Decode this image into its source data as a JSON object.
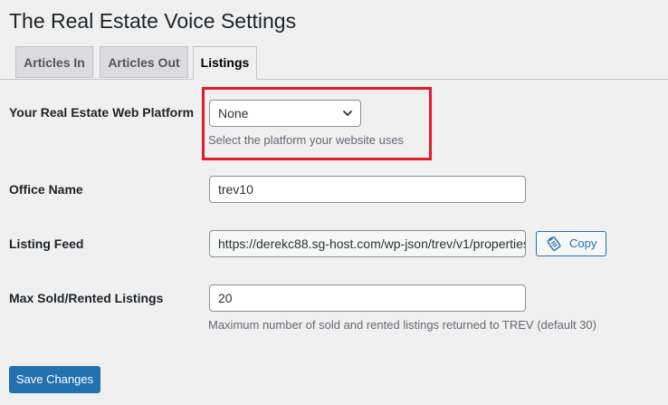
{
  "page": {
    "title": "The Real Estate Voice Settings"
  },
  "tabs": [
    {
      "label": "Articles In",
      "active": false
    },
    {
      "label": "Articles Out",
      "active": false
    },
    {
      "label": "Listings",
      "active": true
    }
  ],
  "platform": {
    "label": "Your Real Estate Web Platform",
    "selected": "None",
    "description": "Select the platform your website uses"
  },
  "office": {
    "label": "Office Name",
    "value": "trev10"
  },
  "feed": {
    "label": "Listing Feed",
    "value": "https://derekc88.sg-host.com/wp-json/trev/v1/properties",
    "copy_label": "Copy"
  },
  "max_listings": {
    "label": "Max Sold/Rented Listings",
    "value": "20",
    "description": "Maximum number of sold and rented listings returned to TREV (default 30)"
  },
  "actions": {
    "save_label": "Save Changes"
  },
  "colors": {
    "accent": "#2271b1",
    "highlight": "#e11d2a",
    "background": "#f0f0f1"
  },
  "icons": {
    "select": "chevron-down-icon",
    "copy": "clipboard-icon"
  }
}
